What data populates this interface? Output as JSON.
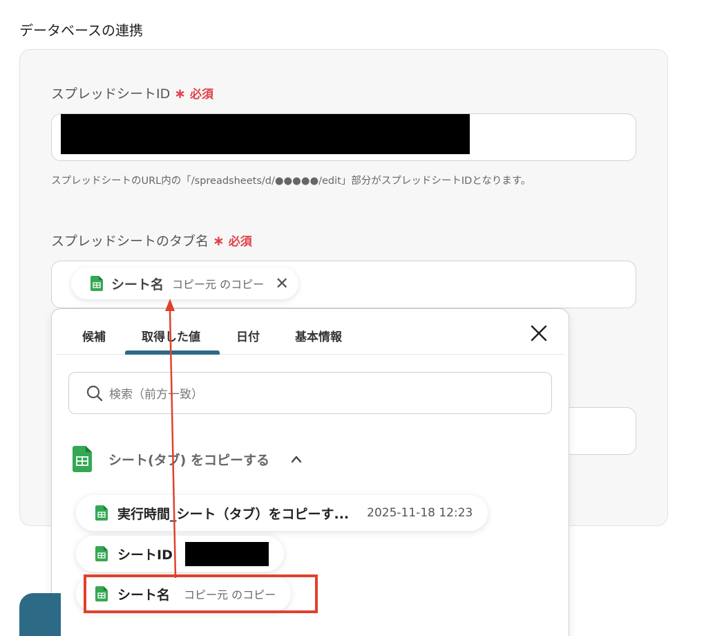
{
  "section_title": "データベースの連携",
  "spreadsheet_id": {
    "label": "スプレッドシートID",
    "required_mark": "∗",
    "required_text": "必須",
    "help": "スプレッドシートのURL内の「/spreadsheets/d/●●●●●/edit」部分がスプレッドシートIDとなります。"
  },
  "tab_name": {
    "label": "スプレッドシートのタブ名",
    "required_mark": "∗",
    "required_text": "必須",
    "chip_main": "シート名",
    "chip_sub": "コピー元 のコピー",
    "chip_close": "✕"
  },
  "popover": {
    "tabs": [
      "候補",
      "取得した値",
      "日付",
      "基本情報"
    ],
    "active_tab_index": 1,
    "search_placeholder": "検索（前方一致）",
    "group_label": "シート(タブ) をコピーする",
    "items": [
      {
        "main": "実行時間_シート（タブ）をコピーす...",
        "date": "2025-11-18 12:23"
      },
      {
        "main": "シートID"
      },
      {
        "main": "シート名",
        "sub": "コピー元 のコピー"
      }
    ]
  },
  "colors": {
    "accent": "#2d6a86",
    "required": "#e0414a",
    "highlight": "#e0412b",
    "sheets_green": "#34a853"
  },
  "icons": [
    "sheets-icon",
    "search-icon",
    "close-icon",
    "chevron-up-icon"
  ]
}
